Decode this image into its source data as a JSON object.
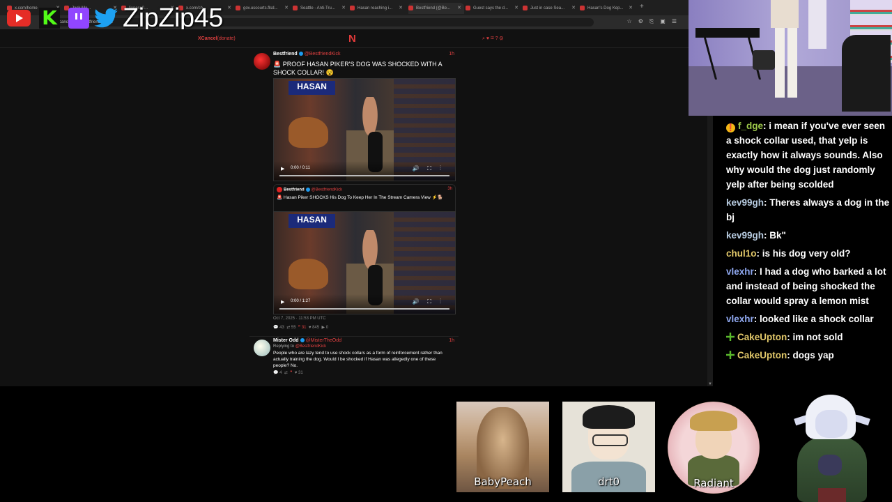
{
  "browser": {
    "tabs": [
      {
        "label": "x.com/home"
      },
      {
        "label": "Jack Ma..."
      },
      {
        "label": "lioness0..."
      },
      {
        "label": "x.com/ch..."
      },
      {
        "label": "gov.uscourts.flsd..."
      },
      {
        "label": "Seattle - Anti-Tru..."
      },
      {
        "label": "Hasan reaching i..."
      },
      {
        "label": "Bestfriend (@Be..."
      },
      {
        "label": "Guest says the d..."
      },
      {
        "label": "Just in case Sea..."
      },
      {
        "label": "Hasan's Dog Kep..."
      }
    ],
    "address": "xcancel.com/Bestfriend/status"
  },
  "overlay": {
    "handle": "ZipZip45",
    "platforms": [
      "youtube-icon",
      "kick-icon",
      "twitch-icon",
      "twitter-icon"
    ]
  },
  "site": {
    "brand": "XCancel",
    "donate": "(donate)",
    "logo": "N",
    "nav_icons": "⌕ ♥ ✉ ? ⚙"
  },
  "tweets": {
    "main": {
      "name": "Bestfriend",
      "handle": "@BestfriendKick",
      "time": "1h",
      "text": "🚨 PROOF HASAN PIKER'S DOG WAS SHOCKED WITH A SHOCK COLLAR! 😵",
      "video_time": "0:00 / 0:11",
      "sign_text": "HASAN"
    },
    "quoted": {
      "name": "Bestfriend",
      "handle": "@BestfriendKick",
      "time": "3h",
      "text": "🚨 Hasan Piker SHOCKS His Dog To Keep Her In The Stream Camera View ⚡🐕",
      "video_time": "0:00 / 1:27",
      "sign_text": "HASAN"
    },
    "date": "Oct 7, 2025 · 11:53 PM UTC",
    "stats": {
      "comments": "43",
      "retweets": "55",
      "quotes": "31",
      "likes": "845",
      "views": "0"
    },
    "reply": {
      "name": "Mister Odd",
      "handle": "@MisterTheOdd",
      "time": "1h",
      "replying_label": "Replying to",
      "replying_to": "@BestfriendKick",
      "text": "People who are lazy tend to use shock collars as a form of reinforcement rather than actually training the dog. Would I be shocked if Hasan was allegedly one of these people? No.",
      "stats": {
        "comments": "4",
        "retweets": "",
        "quotes": "",
        "likes": "31"
      }
    }
  },
  "chat": {
    "messages": [
      {
        "badge": "❗",
        "user": "f_dge",
        "color": "#9ec94a",
        "text": ": i mean if you've ever seen a shock collar used, that yelp is exactly how it always sounds. Also why would the dog just randomly yelp after being scolded"
      },
      {
        "badge": "",
        "user": "kev99gh",
        "color": "#b7cbe0",
        "text": ": Theres always a dog in the bj"
      },
      {
        "badge": "",
        "user": "kev99gh",
        "color": "#b7cbe0",
        "text": ": Bk\""
      },
      {
        "badge": "",
        "user": "chul1o",
        "color": "#e3c96a",
        "text": ": is his dog very old?"
      },
      {
        "badge": "",
        "user": "vlexhr",
        "color": "#8fa8f0",
        "text": ": I had a dog who barked a lot and instead of being shocked the collar would spray a lemon mist"
      },
      {
        "badge": "",
        "user": "vlexhr",
        "color": "#8fa8f0",
        "text": ": looked like a shock collar"
      },
      {
        "badge": "✚",
        "user": "CakeUpton",
        "color": "#e3c96a",
        "text": ": im not sold"
      },
      {
        "badge": "✚",
        "user": "CakeUpton",
        "color": "#e3c96a",
        "text": ": dogs yap"
      }
    ]
  },
  "friends": [
    {
      "label": "BabyPeach"
    },
    {
      "label": "drt0"
    },
    {
      "label": "Radiant"
    }
  ],
  "colors": {
    "accent": "#e04040",
    "verified": "#1d9bf0",
    "page_bg": "#111111"
  }
}
